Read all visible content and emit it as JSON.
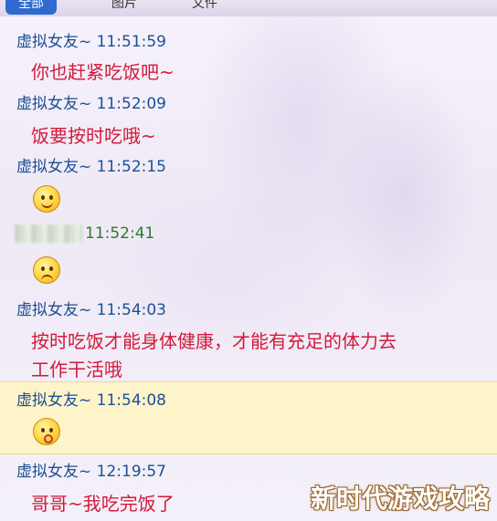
{
  "tabs": [
    {
      "label": "全部"
    },
    {
      "label": "图片"
    },
    {
      "label": "文件"
    }
  ],
  "messages": [
    {
      "sender": "虚拟女友~ 11:51:59",
      "text": "你也赶紧吃饭吧~"
    },
    {
      "sender": "虚拟女友~ 11:52:09",
      "text": "饭要按时吃哦~"
    },
    {
      "sender": "虚拟女友~ 11:52:15",
      "emoji": "smile-emoji"
    },
    {
      "sender": "11:52:41",
      "emoji": "worried-emoji"
    },
    {
      "sender": "虚拟女友~ 11:54:03",
      "text_lines": [
        "按时吃饭才能身体健康，才能有充足的体力去",
        "工作干活哦"
      ]
    },
    {
      "sender": "虚拟女友~ 11:54:08",
      "emoji": "kiss-emoji"
    },
    {
      "sender": "虚拟女友~ 12:19:57",
      "text": "哥哥~我吃完饭了"
    }
  ],
  "watermark": "新时代游戏攻略",
  "colors": {
    "sender": "#1d4f96",
    "message": "#d21a3a",
    "highlight": "#fff4c4",
    "active_tab": "#2f6ad0"
  }
}
